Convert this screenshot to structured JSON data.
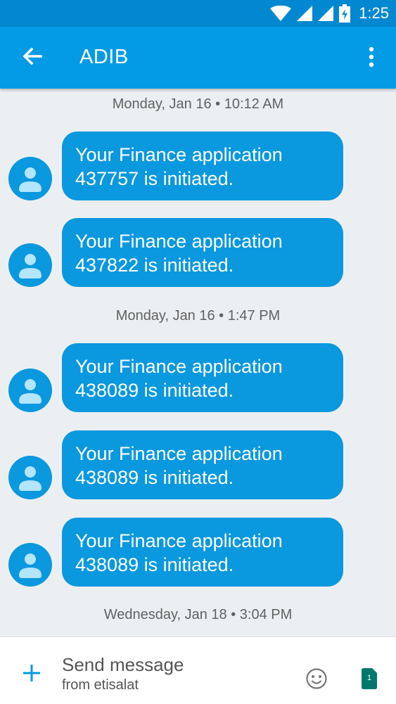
{
  "status_bar": {
    "time": "1:25"
  },
  "app_bar": {
    "title": "ADIB"
  },
  "conversation": {
    "groups": [
      {
        "timestamp": "Monday, Jan 16 • 10:12 AM",
        "messages": [
          {
            "line1": "Your Finance application",
            "line2": "437757 is initiated."
          },
          {
            "line1": "Your Finance application",
            "line2": "437822 is initiated."
          }
        ]
      },
      {
        "timestamp": "Monday, Jan 16 • 1:47 PM",
        "messages": [
          {
            "line1": "Your Finance application",
            "line2": "438089 is initiated."
          },
          {
            "line1": "Your Finance application",
            "line2": "438089 is initiated."
          },
          {
            "line1": "Your Finance application",
            "line2": "438089 is initiated."
          }
        ]
      },
      {
        "timestamp": "Wednesday, Jan 18 • 3:04 PM",
        "messages": []
      }
    ]
  },
  "composer": {
    "placeholder": "Send message",
    "subtitle": "from etisalat",
    "sim_label": "1"
  },
  "colors": {
    "status_bar": "#0288d1",
    "app_bar": "#039be5",
    "bubble": "#0a98de",
    "background": "#eceff1",
    "accent": "#039be5"
  },
  "icons": [
    "wifi-icon",
    "signal-icon",
    "battery-charging-icon",
    "back-arrow-icon",
    "more-vert-icon",
    "avatar-icon",
    "add-icon",
    "emoji-icon",
    "sim-card-icon"
  ]
}
